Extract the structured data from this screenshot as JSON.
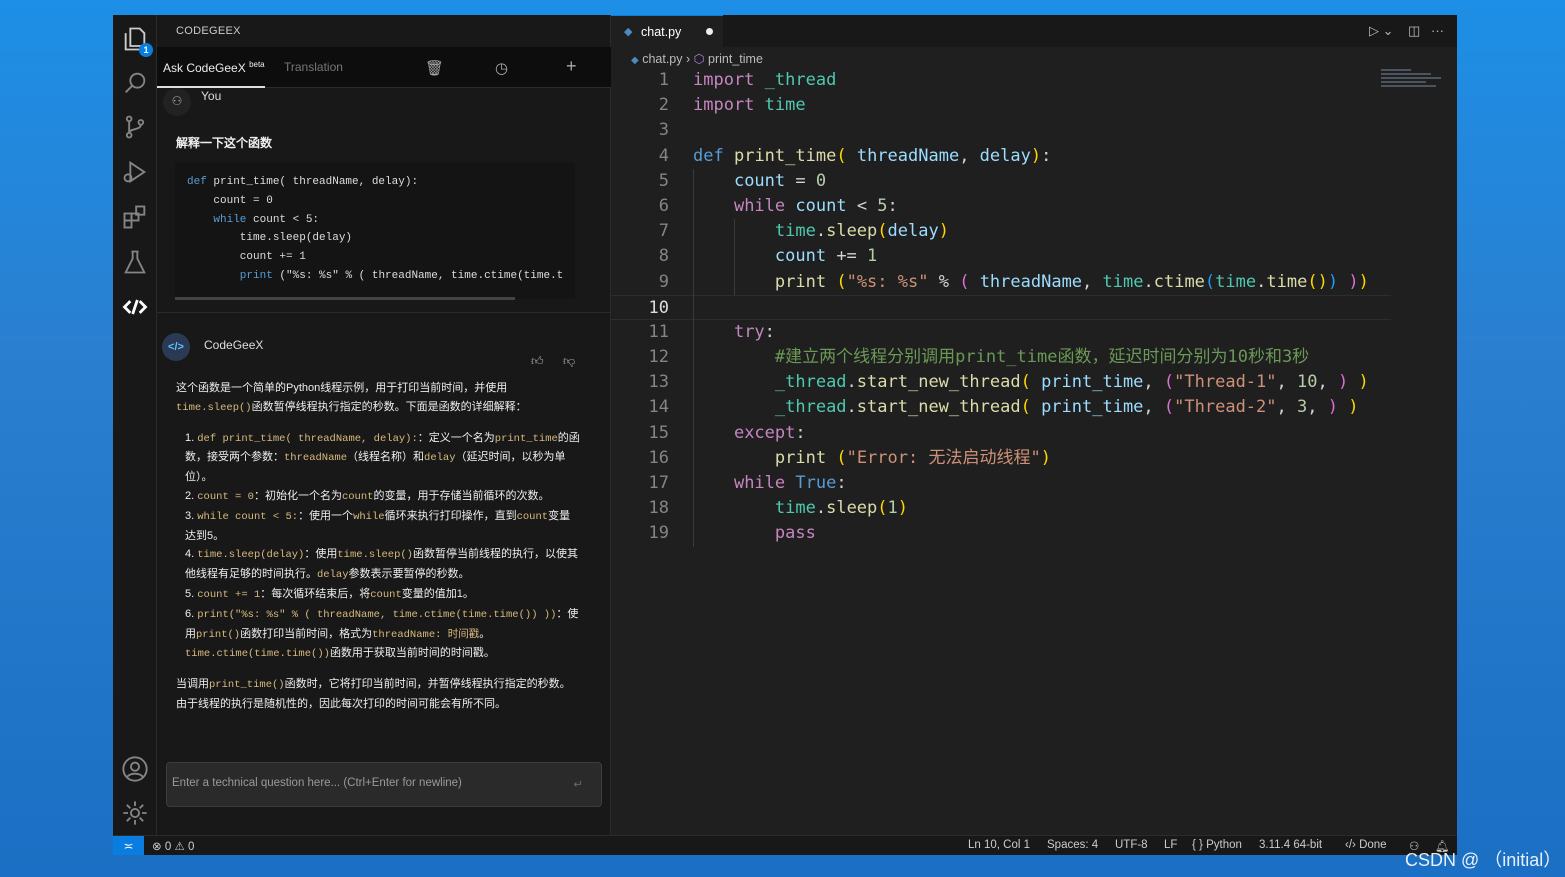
{
  "activity": {
    "explorer_badge": "1",
    "icons": [
      "files-icon",
      "search-icon",
      "source-control-icon",
      "run-debug-icon",
      "extensions-icon",
      "testing-icon",
      "codegeex-icon"
    ],
    "bottom": [
      "account-icon",
      "gear-icon"
    ]
  },
  "panel": {
    "title": "CODEGEEX",
    "tab_ask": "Ask CodeGeeX",
    "tab_ask_sup": "beta",
    "tab_translation": "Translation",
    "user_label": "You",
    "question": "解释一下这个函数",
    "code_block": [
      [
        [
          "d",
          "def "
        ],
        [
          "p",
          "print_time( threadName, delay):"
        ]
      ],
      [
        [
          "p",
          "    count = 0"
        ]
      ],
      [
        [
          "d",
          "    while"
        ],
        [
          "p",
          " count < 5:"
        ]
      ],
      [
        [
          "p",
          "        time.sleep(delay)"
        ]
      ],
      [
        [
          "p",
          "        count += 1"
        ]
      ],
      [
        [
          "d",
          "        print"
        ],
        [
          "p",
          " (\"%s: %s\" % ( threadName, time.ctime(time.t"
        ]
      ]
    ],
    "bot_label": "CodeGeeX",
    "bot_avatar_text": "</>",
    "answer": {
      "intro": [
        [
          "这个函数是一个简单的Python线程示例，用于打印当前时间，并使用",
          0
        ],
        [
          "time.sleep()",
          1
        ],
        [
          "函数暂停线程执行指定的秒数。下面是函数的详细解释：",
          0
        ]
      ],
      "items": [
        [
          [
            "1. ",
            0
          ],
          [
            "def print_time( threadName, delay):",
            1
          ],
          [
            "：定义一个名为",
            0
          ],
          [
            "print_time",
            1
          ],
          [
            "的函数，接受两个参数：",
            0
          ],
          [
            "threadName",
            1
          ],
          [
            "（线程名称）和",
            0
          ],
          [
            "delay",
            1
          ],
          [
            "（延迟时间，以秒为单位）。",
            0
          ]
        ],
        [
          [
            "2. ",
            0
          ],
          [
            "count = 0",
            1
          ],
          [
            "：初始化一个名为",
            0
          ],
          [
            "count",
            1
          ],
          [
            "的变量，用于存储当前循环的次数。",
            0
          ]
        ],
        [
          [
            "3. ",
            0
          ],
          [
            "while count < 5:",
            1
          ],
          [
            "：使用一个",
            0
          ],
          [
            "while",
            1
          ],
          [
            "循环来执行打印操作，直到",
            0
          ],
          [
            "count",
            1
          ],
          [
            "变量达到5。",
            0
          ]
        ],
        [
          [
            "4. ",
            0
          ],
          [
            "time.sleep(delay)",
            1
          ],
          [
            "：使用",
            0
          ],
          [
            "time.sleep()",
            1
          ],
          [
            "函数暂停当前线程的执行，以使其他线程有足够的时间执行。",
            0
          ],
          [
            "delay",
            1
          ],
          [
            "参数表示要暂停的秒数。",
            0
          ]
        ],
        [
          [
            "5. ",
            0
          ],
          [
            "count += 1",
            1
          ],
          [
            "：每次循环结束后，将",
            0
          ],
          [
            "count",
            1
          ],
          [
            "变量的值加1。",
            0
          ]
        ],
        [
          [
            "6. ",
            0
          ],
          [
            "print(\"%s: %s\" % ( threadName, time.ctime(time.time()) ))",
            1
          ],
          [
            "：使用",
            0
          ],
          [
            "print()",
            1
          ],
          [
            "函数打印当前时间，格式为",
            0
          ],
          [
            "threadName: 时间戳",
            1
          ],
          [
            "。",
            0
          ],
          [
            "time.ctime(time.time())",
            1
          ],
          [
            "函数用于获取当前时间的时间戳。",
            0
          ]
        ]
      ],
      "outro": [
        [
          "当调用",
          0
        ],
        [
          "print_time()",
          1
        ],
        [
          "函数时，它将打印当前时间，并暂停线程执行指定的秒数。由于线程的执行是随机性的，因此每次打印的时间可能会有所不同。",
          0
        ]
      ]
    },
    "input_placeholder": "Enter a technical question here... (Ctrl+Enter for newline)"
  },
  "editor": {
    "tab": "chat.py",
    "breadcrumb": [
      "chat.py",
      "print_time"
    ],
    "current_line": 10,
    "lines": [
      [
        [
          "k",
          "import"
        ],
        [
          "p",
          " "
        ],
        [
          "m",
          "_thread"
        ]
      ],
      [
        [
          "k",
          "import"
        ],
        [
          "p",
          " "
        ],
        [
          "m",
          "time"
        ]
      ],
      [],
      [
        [
          "d",
          "def"
        ],
        [
          "p",
          " "
        ],
        [
          "f",
          "print_time"
        ],
        [
          "b1",
          "("
        ],
        [
          "p",
          " "
        ],
        [
          "v",
          "threadName"
        ],
        [
          "p",
          ", "
        ],
        [
          "v",
          "delay"
        ],
        [
          "b1",
          ")"
        ],
        [
          "p",
          ":"
        ]
      ],
      [
        [
          "p",
          "    "
        ],
        [
          "v",
          "count"
        ],
        [
          "p",
          " = "
        ],
        [
          "n",
          "0"
        ]
      ],
      [
        [
          "p",
          "    "
        ],
        [
          "k",
          "while"
        ],
        [
          "p",
          " "
        ],
        [
          "v",
          "count"
        ],
        [
          "p",
          " < "
        ],
        [
          "n",
          "5"
        ],
        [
          "p",
          ":"
        ]
      ],
      [
        [
          "p",
          "        "
        ],
        [
          "m",
          "time"
        ],
        [
          "p",
          "."
        ],
        [
          "f",
          "sleep"
        ],
        [
          "b1",
          "("
        ],
        [
          "v",
          "delay"
        ],
        [
          "b1",
          ")"
        ]
      ],
      [
        [
          "p",
          "        "
        ],
        [
          "v",
          "count"
        ],
        [
          "p",
          " += "
        ],
        [
          "n",
          "1"
        ]
      ],
      [
        [
          "p",
          "        "
        ],
        [
          "f",
          "print"
        ],
        [
          "p",
          " "
        ],
        [
          "b1",
          "("
        ],
        [
          "s",
          "\"%s: %s\""
        ],
        [
          "p",
          " % "
        ],
        [
          "b2",
          "("
        ],
        [
          "p",
          " "
        ],
        [
          "v",
          "threadName"
        ],
        [
          "p",
          ", "
        ],
        [
          "m",
          "time"
        ],
        [
          "p",
          "."
        ],
        [
          "f",
          "ctime"
        ],
        [
          "b3",
          "("
        ],
        [
          "m",
          "time"
        ],
        [
          "p",
          "."
        ],
        [
          "f",
          "time"
        ],
        [
          "b1",
          "()"
        ],
        [
          "b3",
          ")"
        ],
        [
          "p",
          " "
        ],
        [
          "b2",
          ")"
        ],
        [
          "b1",
          ")"
        ]
      ],
      [],
      [
        [
          "p",
          "    "
        ],
        [
          "k",
          "try"
        ],
        [
          "p",
          ":"
        ]
      ],
      [
        [
          "p",
          "        "
        ],
        [
          "c",
          "#建立两个线程分别调用print_time函数，延迟时间分别为10秒和3秒"
        ]
      ],
      [
        [
          "p",
          "        "
        ],
        [
          "m",
          "_thread"
        ],
        [
          "p",
          "."
        ],
        [
          "f",
          "start_new_thread"
        ],
        [
          "b1",
          "("
        ],
        [
          "p",
          " "
        ],
        [
          "v",
          "print_time"
        ],
        [
          "p",
          ", "
        ],
        [
          "b2",
          "("
        ],
        [
          "s",
          "\"Thread-1\""
        ],
        [
          "p",
          ", "
        ],
        [
          "n",
          "10"
        ],
        [
          "p",
          ", "
        ],
        [
          "b2",
          ")"
        ],
        [
          "p",
          " "
        ],
        [
          "b1",
          ")"
        ]
      ],
      [
        [
          "p",
          "        "
        ],
        [
          "m",
          "_thread"
        ],
        [
          "p",
          "."
        ],
        [
          "f",
          "start_new_thread"
        ],
        [
          "b1",
          "("
        ],
        [
          "p",
          " "
        ],
        [
          "v",
          "print_time"
        ],
        [
          "p",
          ", "
        ],
        [
          "b2",
          "("
        ],
        [
          "s",
          "\"Thread-2\""
        ],
        [
          "p",
          ", "
        ],
        [
          "n",
          "3"
        ],
        [
          "p",
          ", "
        ],
        [
          "b2",
          ")"
        ],
        [
          "p",
          " "
        ],
        [
          "b1",
          ")"
        ]
      ],
      [
        [
          "p",
          "    "
        ],
        [
          "k",
          "except"
        ],
        [
          "p",
          ":"
        ]
      ],
      [
        [
          "p",
          "        "
        ],
        [
          "f",
          "print"
        ],
        [
          "p",
          " "
        ],
        [
          "b1",
          "("
        ],
        [
          "s",
          "\"Error: 无法启动线程\""
        ],
        [
          "b1",
          ")"
        ]
      ],
      [
        [
          "p",
          "    "
        ],
        [
          "k",
          "while"
        ],
        [
          "p",
          " "
        ],
        [
          "d",
          "True"
        ],
        [
          "p",
          ":"
        ]
      ],
      [
        [
          "p",
          "        "
        ],
        [
          "m",
          "time"
        ],
        [
          "p",
          "."
        ],
        [
          "f",
          "sleep"
        ],
        [
          "b1",
          "("
        ],
        [
          "n",
          "1"
        ],
        [
          "b1",
          ")"
        ]
      ],
      [
        [
          "p",
          "        "
        ],
        [
          "k",
          "pass"
        ]
      ]
    ]
  },
  "status": {
    "errors": "0",
    "warnings": "0",
    "position": "Ln 10, Col 1",
    "spaces": "Spaces: 4",
    "encoding": "UTF-8",
    "eol": "LF",
    "language": "Python",
    "interpreter": "3.11.4 64-bit",
    "codegeex": "Done"
  },
  "watermark": "CSDN @ （initial）",
  "colors": {
    "accent": "#0a7ee0",
    "background": "#1f1f1f"
  }
}
